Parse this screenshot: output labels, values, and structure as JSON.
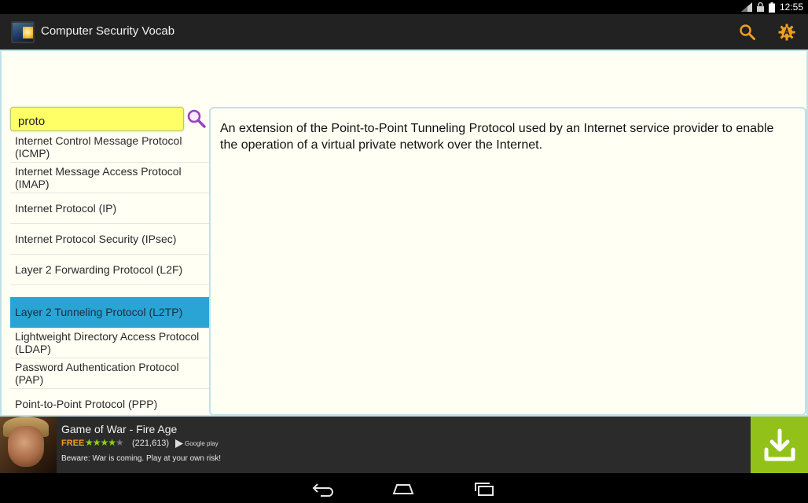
{
  "status_bar": {
    "time": "12:55"
  },
  "app": {
    "title": "Computer Security Vocab",
    "search_action": "search-icon",
    "settings_action": "gear-icon"
  },
  "search": {
    "value": "proto"
  },
  "terms": [
    {
      "label": "Internet Control Message Protocol (ICMP)",
      "selected": false
    },
    {
      "label": "Internet Message Access Protocol (IMAP)",
      "selected": false
    },
    {
      "label": "Internet Protocol (IP)",
      "selected": false
    },
    {
      "label": "Internet Protocol Security (IPsec)",
      "selected": false
    },
    {
      "label": "Layer 2 Forwarding Protocol (L2F)",
      "selected": false
    },
    {
      "label": "Layer 2 Tunneling Protocol (L2TP)",
      "selected": true
    },
    {
      "label": "Lightweight Directory Access Protocol (LDAP)",
      "selected": false
    },
    {
      "label": "Password Authentication Protocol (PAP)",
      "selected": false
    },
    {
      "label": "Point-to-Point Protocol (PPP)",
      "selected": false
    }
  ],
  "definition": {
    "text": "An extension of the Point-to-Point Tunneling Protocol used by an Internet service provider to enable the operation of a virtual private network over the Internet."
  },
  "ad": {
    "title": "Game of War - Fire Age",
    "price": "FREE",
    "rating_stars": 4.5,
    "rating_count": "(221,613)",
    "store_badge": "Google play",
    "description": "Beware: War is coming. Play at your own risk!"
  },
  "colors": {
    "accent_selected": "#2aa4d4",
    "search_highlight": "#ffff66",
    "action_bar": "#222222",
    "action_icon": "#f0a020",
    "ad_download": "#92c21a",
    "panel_border": "#bfe2e8"
  }
}
